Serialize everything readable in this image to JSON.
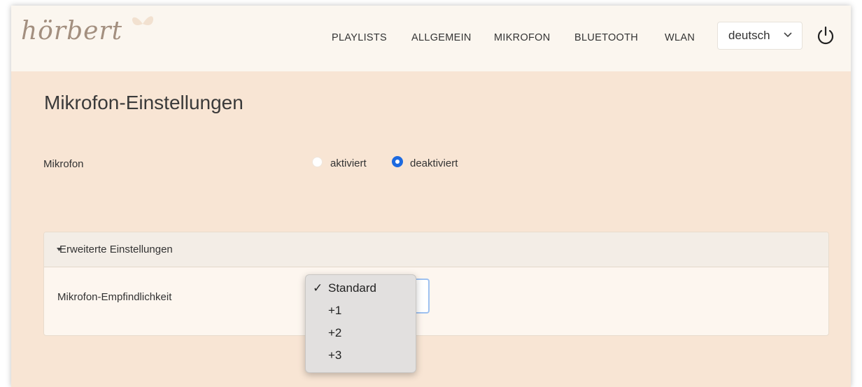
{
  "header": {
    "logo_text": "hörbert",
    "nav": [
      "PLAYLISTS",
      "ALLGEMEIN",
      "MIKROFON",
      "BLUETOOTH",
      "WLAN"
    ],
    "language": {
      "selected": "deutsch"
    },
    "power_icon": "power-icon"
  },
  "page": {
    "title": "Mikrofon-Einstellungen",
    "microphone": {
      "label": "Mikrofon",
      "options": [
        "aktiviert",
        "deaktiviert"
      ],
      "selected": "deaktiviert"
    },
    "advanced": {
      "header": "Erweiterte Einstellungen",
      "sensitivity_label": "Mikrofon-Empfindlichkeit",
      "dropdown": {
        "options": [
          "Standard",
          "+1",
          "+2",
          "+3"
        ],
        "selected": "Standard",
        "check": "✓"
      }
    }
  },
  "colors": {
    "background": "#f8e5d4",
    "header_bg": "#fbf6ef",
    "accent": "#1d6ae0",
    "logo": "#a38f7f"
  }
}
